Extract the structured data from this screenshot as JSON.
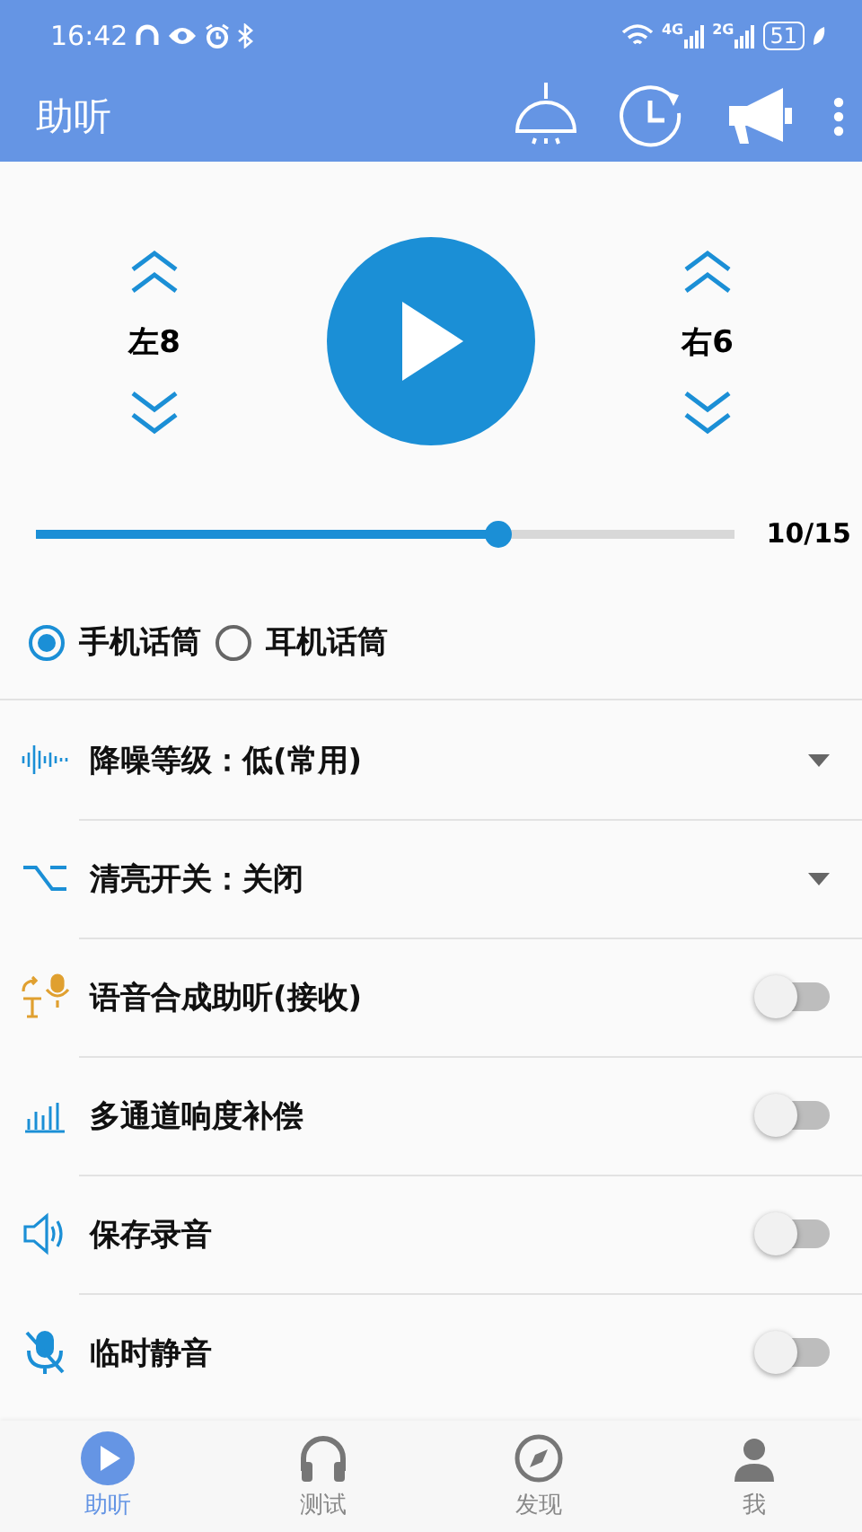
{
  "status_bar": {
    "time": "16:42",
    "network_1": "4G",
    "network_2": "2G",
    "battery": "51"
  },
  "app_bar": {
    "title": "助听"
  },
  "volume": {
    "left": "左8",
    "right": "右6"
  },
  "gain": {
    "level": 0.667,
    "reading": "10/15"
  },
  "microphones": [
    {
      "label": "手机话筒",
      "selected": true
    },
    {
      "label": "耳机话筒",
      "selected": false
    }
  ],
  "settings": [
    {
      "kind": "dropdown",
      "label": "降噪等级：低(常用)"
    },
    {
      "kind": "dropdown",
      "label": "清亮开关：关闭"
    },
    {
      "kind": "toggle",
      "label": "语音合成助听(接收)",
      "on": false
    },
    {
      "kind": "toggle",
      "label": "多通道响度补偿",
      "on": false
    },
    {
      "kind": "toggle",
      "label": "保存录音",
      "on": false
    },
    {
      "kind": "toggle",
      "label": "临时静音",
      "on": false
    }
  ],
  "bottom_nav": [
    {
      "label": "助听",
      "selected": true
    },
    {
      "label": "测试",
      "selected": false
    },
    {
      "label": "发现",
      "selected": false
    },
    {
      "label": "我",
      "selected": false
    }
  ]
}
